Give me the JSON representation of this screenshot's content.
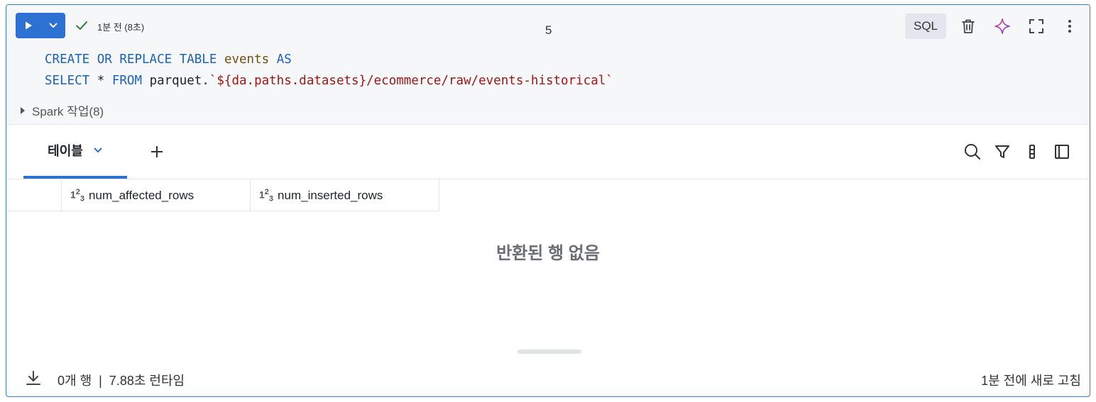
{
  "toolbar": {
    "status_text": "1분 전 (8초)",
    "cell_number": "5",
    "language": "SQL"
  },
  "code": {
    "line1": {
      "kw1": "CREATE",
      "kw2": "OR",
      "kw3": "REPLACE",
      "kw4": "TABLE",
      "ident": "events",
      "kw5": "AS"
    },
    "line2": {
      "kw1": "SELECT",
      "star": "*",
      "kw2": "FROM",
      "plain": "parquet.",
      "string": "`${da.paths.datasets}/ecommerce/raw/events-historical`"
    }
  },
  "spark_jobs_label": "Spark 작업(8)",
  "results": {
    "tab_label": "테이블",
    "columns": [
      {
        "type_icon": "123",
        "name": "num_affected_rows"
      },
      {
        "type_icon": "123",
        "name": "num_inserted_rows"
      }
    ],
    "empty_message": "반환된 행 없음"
  },
  "footer": {
    "summary": "0개 행  |  7.88초 런타임",
    "refresh": "1분 전에 새로 고침"
  },
  "colors": {
    "accent": "#2d72d2",
    "keyword": "#1c62b8",
    "string": "#a31515",
    "identifier": "#6b5010",
    "success": "#2e7d32"
  }
}
